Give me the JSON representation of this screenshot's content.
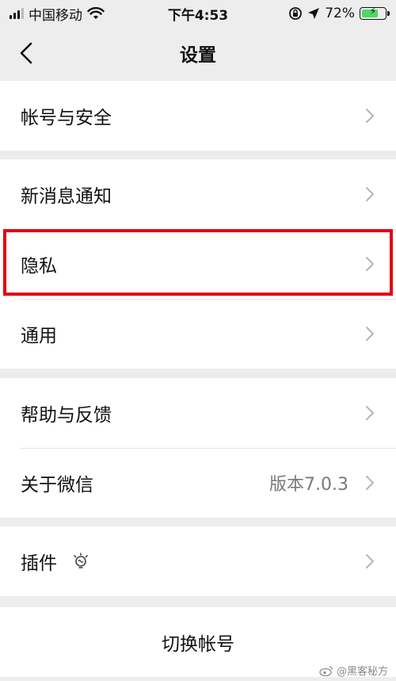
{
  "status": {
    "carrier": "中国移动",
    "time": "下午4:53",
    "battery_level": 72,
    "battery_text": "72%"
  },
  "nav": {
    "title": "设置"
  },
  "groups": [
    {
      "items": [
        {
          "label": "帐号与安全"
        }
      ]
    },
    {
      "items": [
        {
          "label": "新消息通知"
        },
        {
          "label": "隐私"
        },
        {
          "label": "通用"
        }
      ]
    },
    {
      "items": [
        {
          "label": "帮助与反馈"
        },
        {
          "label": "关于微信",
          "value": "版本7.0.3"
        }
      ]
    },
    {
      "items": [
        {
          "label": "插件"
        }
      ]
    }
  ],
  "switch_account": {
    "label": "切换帐号"
  },
  "watermark": {
    "text": "@黑客秘方"
  },
  "colors": {
    "highlight": "#e30613",
    "battery": "#4cd964"
  }
}
